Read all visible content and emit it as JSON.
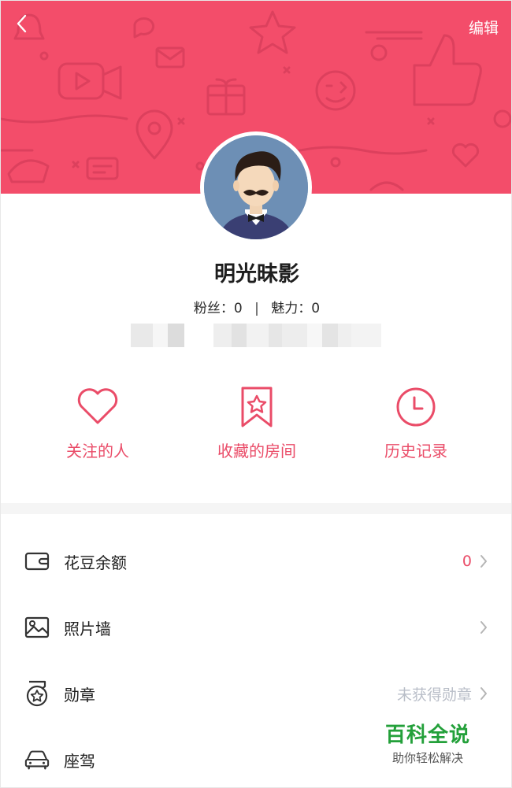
{
  "header": {
    "edit_label": "编辑",
    "background_color": "#f34d6a"
  },
  "profile": {
    "name": "明光昧影",
    "fans_label": "粉丝：",
    "fans_count": "0",
    "separator": "|",
    "charm_label": "魅力：",
    "charm_count": "0"
  },
  "quick_actions": [
    {
      "label": "关注的人",
      "icon": "heart-icon"
    },
    {
      "label": "收藏的房间",
      "icon": "bookmark-star-icon"
    },
    {
      "label": "历史记录",
      "icon": "clock-icon"
    }
  ],
  "menu": [
    {
      "label": "花豆余额",
      "value": "0",
      "icon": "wallet-icon",
      "value_color": "#ea4c68"
    },
    {
      "label": "照片墙",
      "value": "",
      "icon": "image-icon",
      "value_color": "#b5b5b5"
    },
    {
      "label": "勋章",
      "value": "未获得勋章",
      "icon": "medal-icon",
      "value_color": "#b9bec8"
    },
    {
      "label": "座驾",
      "value": "",
      "icon": "car-icon",
      "value_color": "#b5b5b5"
    }
  ],
  "watermark": {
    "title": "百科全说",
    "subtitle": "助你轻松解决"
  },
  "colors": {
    "accent": "#ea4c68",
    "banner": "#f34d6a",
    "text": "#1e1e1e"
  }
}
